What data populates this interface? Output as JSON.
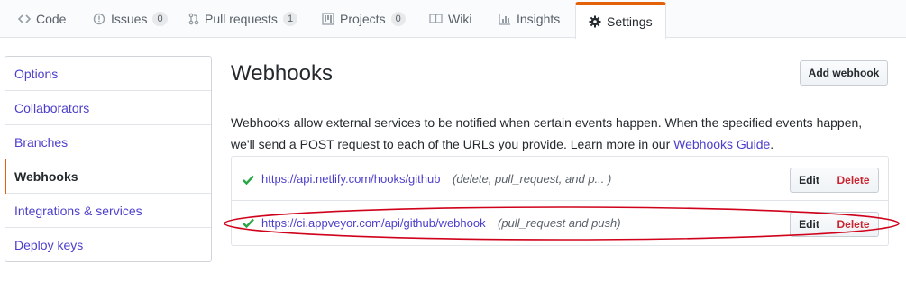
{
  "tabs": [
    {
      "label": "Code",
      "icon": "code-icon"
    },
    {
      "label": "Issues",
      "icon": "issue-icon",
      "count": "0"
    },
    {
      "label": "Pull requests",
      "icon": "pull-request-icon",
      "count": "1"
    },
    {
      "label": "Projects",
      "icon": "project-icon",
      "count": "0"
    },
    {
      "label": "Wiki",
      "icon": "book-icon"
    },
    {
      "label": "Insights",
      "icon": "graph-icon"
    },
    {
      "label": "Settings",
      "icon": "gear-icon",
      "selected": true
    }
  ],
  "sidebar": {
    "items": [
      {
        "label": "Options"
      },
      {
        "label": "Collaborators"
      },
      {
        "label": "Branches"
      },
      {
        "label": "Webhooks",
        "active": true
      },
      {
        "label": "Integrations & services"
      },
      {
        "label": "Deploy keys"
      }
    ]
  },
  "main": {
    "title": "Webhooks",
    "add_button": "Add webhook",
    "description_text": "Webhooks allow external services to be notified when certain events happen. When the specified events happen, we'll send a POST request to each of the URLs you provide. Learn more in our",
    "description_link": "Webhooks Guide",
    "description_end": "."
  },
  "webhooks": [
    {
      "url": "https://api.netlify.com/hooks/github",
      "events": "(delete, pull_request, and p... )",
      "status": "success",
      "edit_label": "Edit",
      "delete_label": "Delete"
    },
    {
      "url": "https://ci.appveyor.com/api/github/webhook",
      "events": "(pull_request and push)",
      "status": "success",
      "edit_label": "Edit",
      "delete_label": "Delete",
      "highlighted": true
    }
  ],
  "colors": {
    "accent": "#e36209",
    "link": "#4c3fcb",
    "success": "#28a745",
    "danger": "#cb2431",
    "highlight": "#d0021b"
  }
}
